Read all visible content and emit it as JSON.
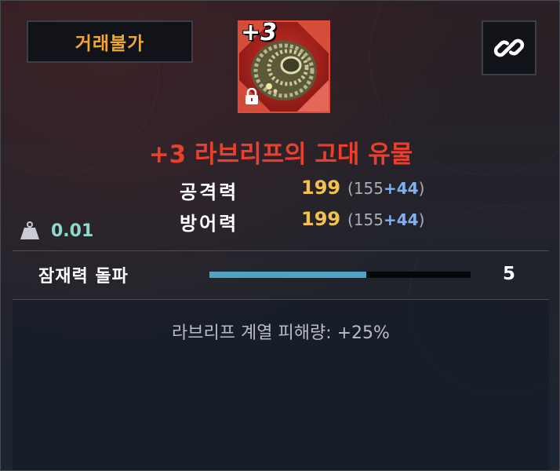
{
  "tooltip": {
    "trade_status": "거래불가",
    "link_icon": "link-icon",
    "item": {
      "upgrade_level": "+3",
      "icon": "ancient-relic-shell-icon",
      "locked": true,
      "name": "+3 라브리프의 고대 유물",
      "name_color": "#e8402c"
    },
    "stats": [
      {
        "label": "공격력",
        "value": "199",
        "base": "155",
        "bonus": "+44"
      },
      {
        "label": "방어력",
        "value": "199",
        "base": "155",
        "bonus": "+44"
      }
    ],
    "weight": {
      "icon": "weight-icon",
      "value": "0.01"
    },
    "potential": {
      "label": "잠재력 돌파",
      "value": "5",
      "progress": 0.6
    },
    "effect": "라브리프 계열 피해량: +25%"
  },
  "colors": {
    "trade_status": "#f0a830",
    "stat_value": "#f2c14e",
    "stat_bonus": "#7fb2f5",
    "weight_value": "#8fdacc",
    "potential_fill": "#4ea4c6"
  }
}
